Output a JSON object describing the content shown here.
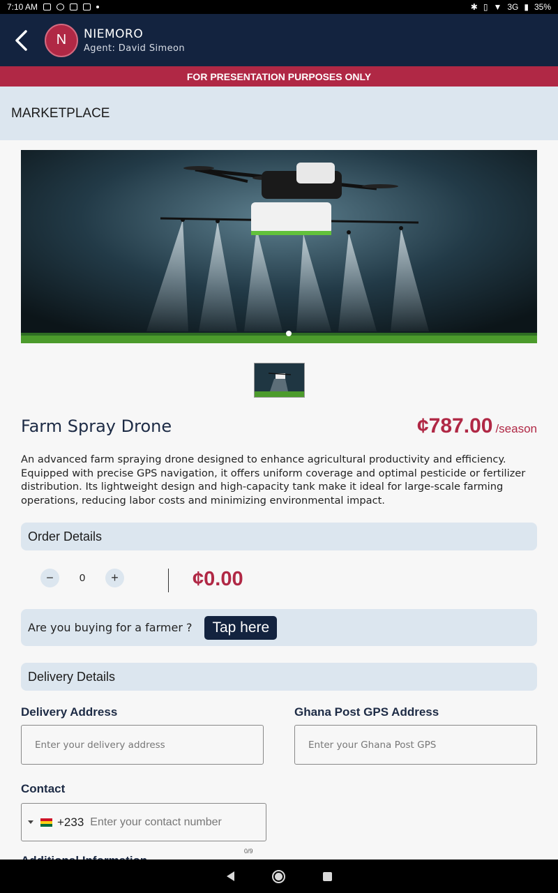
{
  "status_bar": {
    "time": "7:10 AM",
    "network": "3G",
    "battery": "35%"
  },
  "header": {
    "avatar_initial": "N",
    "name": "NIEMORO",
    "agent": "Agent: David Simeon"
  },
  "banner": "FOR PRESENTATION PURPOSES ONLY",
  "section_title": "MARKETPLACE",
  "product": {
    "title": "Farm Spray Drone",
    "price": "¢787.00",
    "price_unit": "/season",
    "description": "An advanced farm spraying drone designed to enhance agricultural productivity and efficiency. Equipped with precise GPS navigation, it offers uniform coverage and optimal pesticide or fertilizer distribution. Its lightweight design and high-capacity tank make it ideal for large-scale farming operations, reducing labor costs and minimizing environmental impact."
  },
  "order": {
    "heading": "Order Details",
    "quantity": "0",
    "minus": "−",
    "plus": "+",
    "total": "¢0.00"
  },
  "farmer_prompt": {
    "question": "Are you buying for a farmer ?",
    "button": "Tap here"
  },
  "delivery": {
    "heading": "Delivery Details",
    "address_label": "Delivery Address",
    "address_placeholder": "Enter your delivery address",
    "gps_label": "Ghana Post GPS Address",
    "gps_placeholder": "Enter your Ghana Post GPS"
  },
  "contact": {
    "label": "Contact",
    "country_code": "+233",
    "placeholder": "Enter your contact number",
    "counter": "0/9"
  },
  "next_section_label": "Additional Information"
}
